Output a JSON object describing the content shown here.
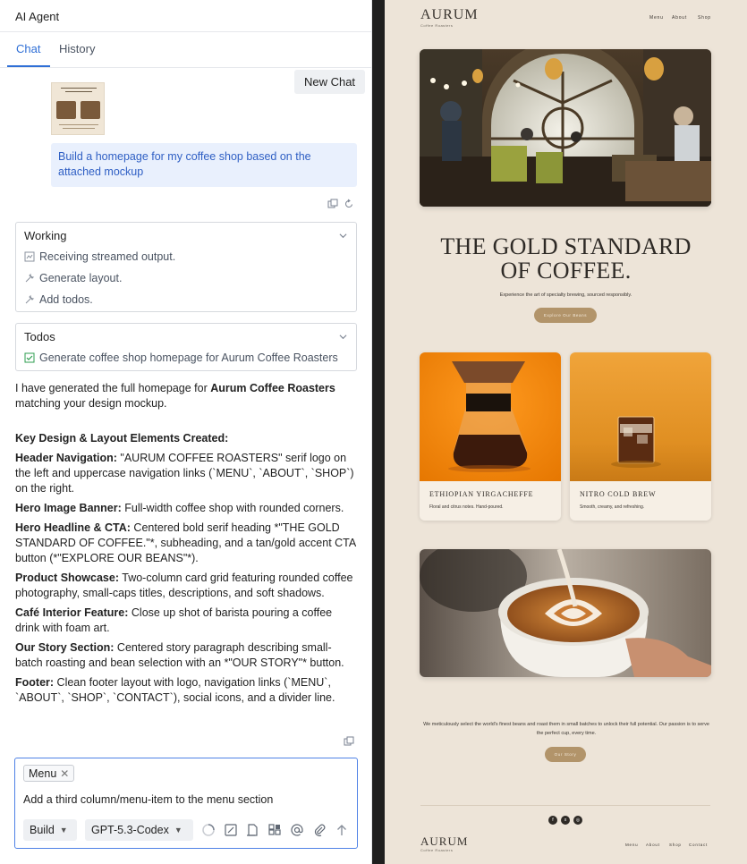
{
  "panel": {
    "title": "AI Agent",
    "tabs": [
      {
        "label": "Chat"
      },
      {
        "label": "History"
      }
    ],
    "new_chat_label": "New Chat"
  },
  "conversation": {
    "user_message": "Build a homepage for my coffee shop based on the attached mockup",
    "working": {
      "title": "Working",
      "steps": [
        "Receiving streamed output.",
        "Generate layout.",
        "Add todos."
      ]
    },
    "todos": {
      "title": "Todos",
      "items": [
        "Generate coffee shop homepage for Aurum Coffee Roasters"
      ]
    },
    "reply": {
      "intro_pre": "I have generated the full homepage for ",
      "intro_bold": "Aurum Coffee Roasters",
      "intro_post": " matching your design mockup.",
      "section_title": "Key Design & Layout Elements Created:",
      "items": [
        {
          "label": "Header Navigation:",
          "text": " \"AURUM COFFEE ROASTERS\" serif logo on the left and uppercase navigation links (`MENU`, `ABOUT`, `SHOP`) on the right."
        },
        {
          "label": "Hero Image Banner:",
          "text": " Full-width coffee shop with rounded corners."
        },
        {
          "label": "Hero Headline & CTA:",
          "text": " Centered bold serif heading *\"THE GOLD STANDARD OF COFFEE.\"*, subheading, and a tan/gold accent CTA button (*\"EXPLORE OUR BEANS\"*)."
        },
        {
          "label": "Product Showcase:",
          "text": " Two-column card grid featuring rounded coffee photography, small-caps titles, descriptions, and soft shadows."
        },
        {
          "label": "Café Interior Feature:",
          "text": " Close up shot of barista pouring a coffee drink with foam art."
        },
        {
          "label": "Our Story Section:",
          "text": " Centered story paragraph describing small-batch roasting and bean selection with an *\"OUR STORY\"* button."
        },
        {
          "label": "Footer:",
          "text": " Clean footer layout with logo, navigation links (`MENU`, `ABOUT`, `SHOP`, `CONTACT`), social icons, and a divider line."
        }
      ]
    }
  },
  "composer": {
    "chip_label": "Menu",
    "input_value": "Add a third column/menu-item to the menu section",
    "mode_label": "Build",
    "model_label": "GPT-5.3-Codex"
  },
  "preview": {
    "logo": "AURUM",
    "logo_sub": "Coffee Roasters",
    "nav": [
      "Menu",
      "About",
      "Shop"
    ],
    "headline_line1": "THE GOLD STANDARD",
    "headline_line2": "OF COFFEE.",
    "subheading": "Experience the art of specialty brewing, sourced responsibly.",
    "cta_label": "Explore Our Beans",
    "cards": [
      {
        "title": "ETHIOPIAN YIRGACHEFFE",
        "desc": "Floral and citrus notes. Hand-poured."
      },
      {
        "title": "NITRO COLD BREW",
        "desc": "Smooth, creamy, and refreshing."
      }
    ],
    "story_text": "We meticulously select the world's finest beans and roast them in small batches to unlock their full potential. Our passion is to serve the perfect cup, every time.",
    "story_cta": "Our Story",
    "social": [
      "f",
      "x",
      "◎"
    ],
    "footer_logo": "AURUM",
    "footer_logo_sub": "Coffee Roasters",
    "footer_nav": [
      "Menu",
      "About",
      "Shop",
      "Contact"
    ]
  },
  "colors": {
    "accent": "#2f6fd6",
    "gold": "#b2946a",
    "cream": "#ede4d8"
  }
}
